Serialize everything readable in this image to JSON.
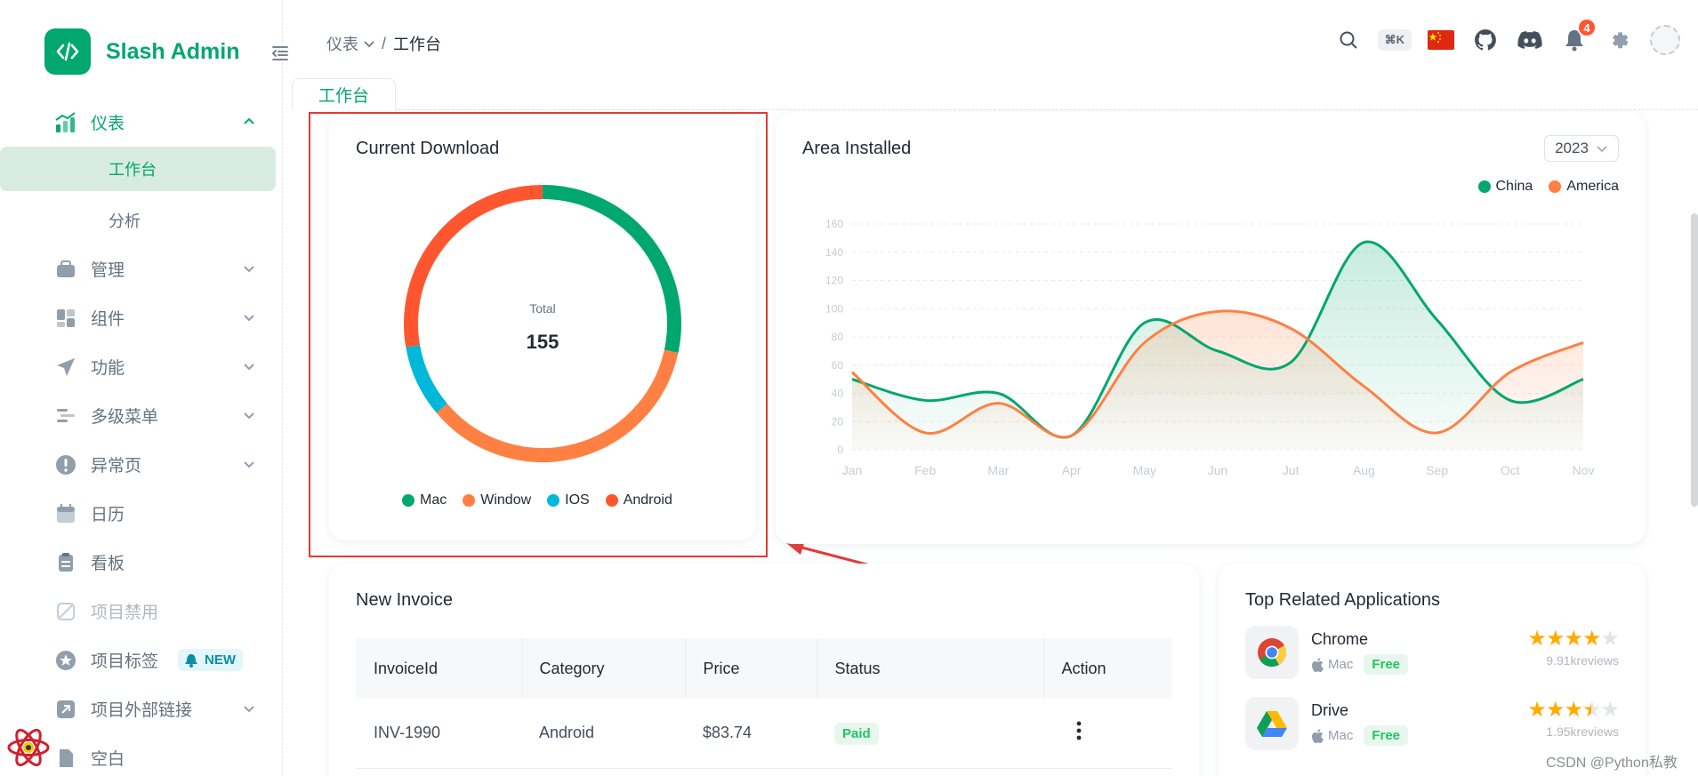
{
  "brand": {
    "name": "Slash Admin",
    "accent": "#00a76f"
  },
  "sidebar": {
    "items": [
      {
        "label": "仪表",
        "icon": "dashboard-chart-icon",
        "open": true
      },
      {
        "label": "管理",
        "icon": "management-icon"
      },
      {
        "label": "组件",
        "icon": "components-icon"
      },
      {
        "label": "功能",
        "icon": "paper-plane-icon"
      },
      {
        "label": "多级菜单",
        "icon": "multilevel-menu-icon"
      },
      {
        "label": "异常页",
        "icon": "exclamation-icon"
      },
      {
        "label": "日历",
        "icon": "calendar-icon"
      },
      {
        "label": "看板",
        "icon": "clipboard-icon"
      },
      {
        "label": "项目禁用",
        "icon": "disabled-icon",
        "disabled": true
      },
      {
        "label": "项目标签",
        "icon": "star-badge-icon",
        "badge": "NEW"
      },
      {
        "label": "项目外部链接",
        "icon": "external-link-icon"
      },
      {
        "label": "空白",
        "icon": "blank-page-icon"
      }
    ],
    "sub_items": [
      {
        "label": "工作台",
        "active": true
      },
      {
        "label": "分析"
      }
    ]
  },
  "header": {
    "breadcrumb_parent": "仪表",
    "breadcrumb_separator": "/",
    "breadcrumb_current": "工作台",
    "shortcut": "⌘K",
    "notifications_count": "4"
  },
  "tabs": [
    {
      "label": "工作台"
    }
  ],
  "current_download": {
    "title": "Current Download",
    "total_label": "Total",
    "total_value": "155"
  },
  "area_installed": {
    "title": "Area Installed",
    "year": "2023"
  },
  "invoice": {
    "title": "New Invoice",
    "columns": [
      "InvoiceId",
      "Category",
      "Price",
      "Status",
      "Action"
    ],
    "rows": [
      {
        "id": "INV-1990",
        "category": "Android",
        "price": "$83.74",
        "status": "Paid"
      }
    ]
  },
  "top_apps": {
    "title": "Top Related Applications",
    "items": [
      {
        "name": "Chrome",
        "platform": "Mac",
        "price": "Free",
        "rating": 4,
        "reviews": "9.91kreviews",
        "icon": "chrome-icon"
      },
      {
        "name": "Drive",
        "platform": "Mac",
        "price": "Free",
        "rating": 3.5,
        "reviews": "1.95kreviews",
        "icon": "google-drive-icon"
      }
    ]
  },
  "watermark": "CSDN @Python私教",
  "chart_data": [
    {
      "type": "pie",
      "variant": "donut",
      "categories": [
        "Mac",
        "Window",
        "IOS",
        "Android"
      ],
      "values": [
        44,
        55,
        13,
        43
      ],
      "colors": [
        "#00a76f",
        "#ff8042",
        "#00b8d9",
        "#ff5630"
      ],
      "legend": "bottom"
    },
    {
      "type": "area",
      "categories": [
        "Jan",
        "Feb",
        "Mar",
        "Apr",
        "May",
        "Jun",
        "Jut",
        "Aug",
        "Sep",
        "Oct",
        "Nov"
      ],
      "series": [
        {
          "name": "China",
          "color": "#00a76f",
          "values": [
            50,
            35,
            40,
            10,
            90,
            70,
            62,
            147,
            92,
            35,
            50
          ]
        },
        {
          "name": "America",
          "color": "#ff8042",
          "values": [
            55,
            12,
            33,
            10,
            76,
            98,
            86,
            45,
            12,
            55,
            76
          ]
        }
      ],
      "yticks": [
        0,
        20,
        40,
        60,
        80,
        100,
        120,
        140,
        160
      ],
      "ylim": [
        0,
        160
      ],
      "grid": true,
      "legend": "top-right"
    }
  ]
}
